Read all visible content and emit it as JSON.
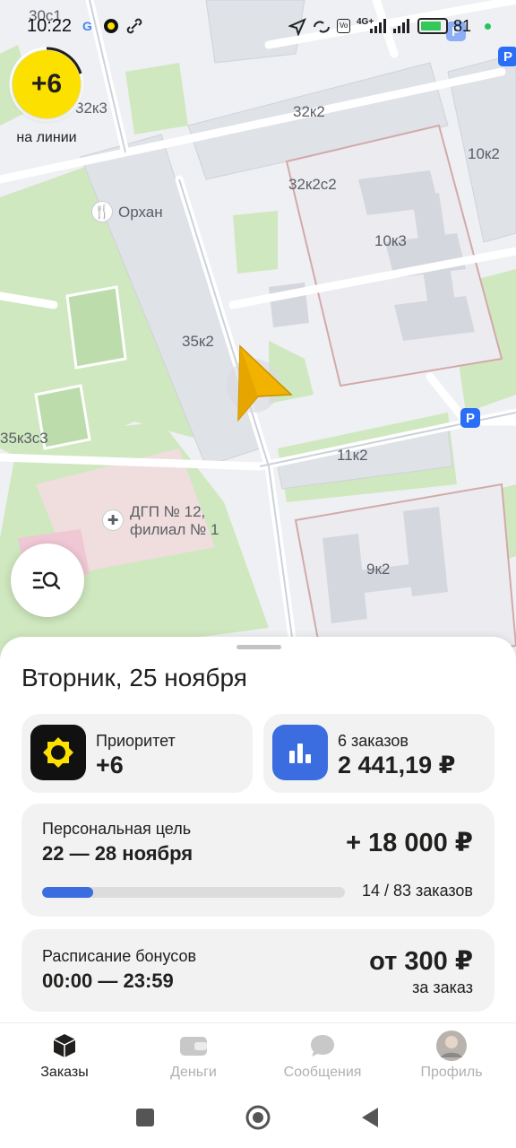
{
  "status_bar": {
    "time": "10:22",
    "battery_percent": "81",
    "icons": [
      "google-icon",
      "yandex-pro-icon",
      "link-icon",
      "location-arrow-icon",
      "sync-icon",
      "volte-icon",
      "signal-4g-icon",
      "signal-icon",
      "battery-charging-icon"
    ],
    "network_label": "4G+"
  },
  "map": {
    "labels": [
      "30с1",
      "32к3",
      "32к2",
      "10к2",
      "32к2с2",
      "Орхан",
      "10к3",
      "35к2",
      "11к2",
      "35к3с3",
      "ДГП № 12,",
      "филиал № 1",
      "9к2"
    ],
    "poi_icons": [
      "restaurant-icon",
      "hospital-icon"
    ],
    "parking_label": "P",
    "colors": {
      "park": "#cfe8bf",
      "building": "#dfe2e7",
      "road": "#ffffff",
      "highlight_building": "#ececf0",
      "hospital_zone": "#f6dbe5"
    }
  },
  "line_status": {
    "count": "+6",
    "label": "на линии"
  },
  "sheet": {
    "title": "Вторник, 25 ноября",
    "priority": {
      "caption": "Приоритет",
      "value": "+6",
      "icon": "priority-badge-icon",
      "icon_bg": "#111111",
      "icon_accent": "#fce000"
    },
    "orders": {
      "caption": "6 заказов",
      "value": "2 441,19 ₽",
      "icon": "bar-chart-icon",
      "icon_bg": "#3b6ce0"
    },
    "goal": {
      "title": "Персональная цель",
      "dates": "22 — 28 ноября",
      "reward": "+ 18 000 ₽",
      "progress_text": "14 / 83 заказов",
      "progress_fraction": 0.169,
      "bar_color": "#3b6ce0"
    },
    "bonus": {
      "title": "Расписание бонусов",
      "time": "00:00 — 23:59",
      "amount": "от 300 ₽",
      "per": "за заказ"
    }
  },
  "tabs": [
    {
      "label": "Заказы",
      "icon": "orders-cube-icon",
      "active": true
    },
    {
      "label": "Деньги",
      "icon": "wallet-icon",
      "active": false
    },
    {
      "label": "Сообщения",
      "icon": "chat-bubble-icon",
      "active": false
    },
    {
      "label": "Профиль",
      "icon": "avatar-icon",
      "active": false
    }
  ],
  "nav": {
    "buttons": [
      "recents-button",
      "home-button",
      "back-button"
    ]
  }
}
